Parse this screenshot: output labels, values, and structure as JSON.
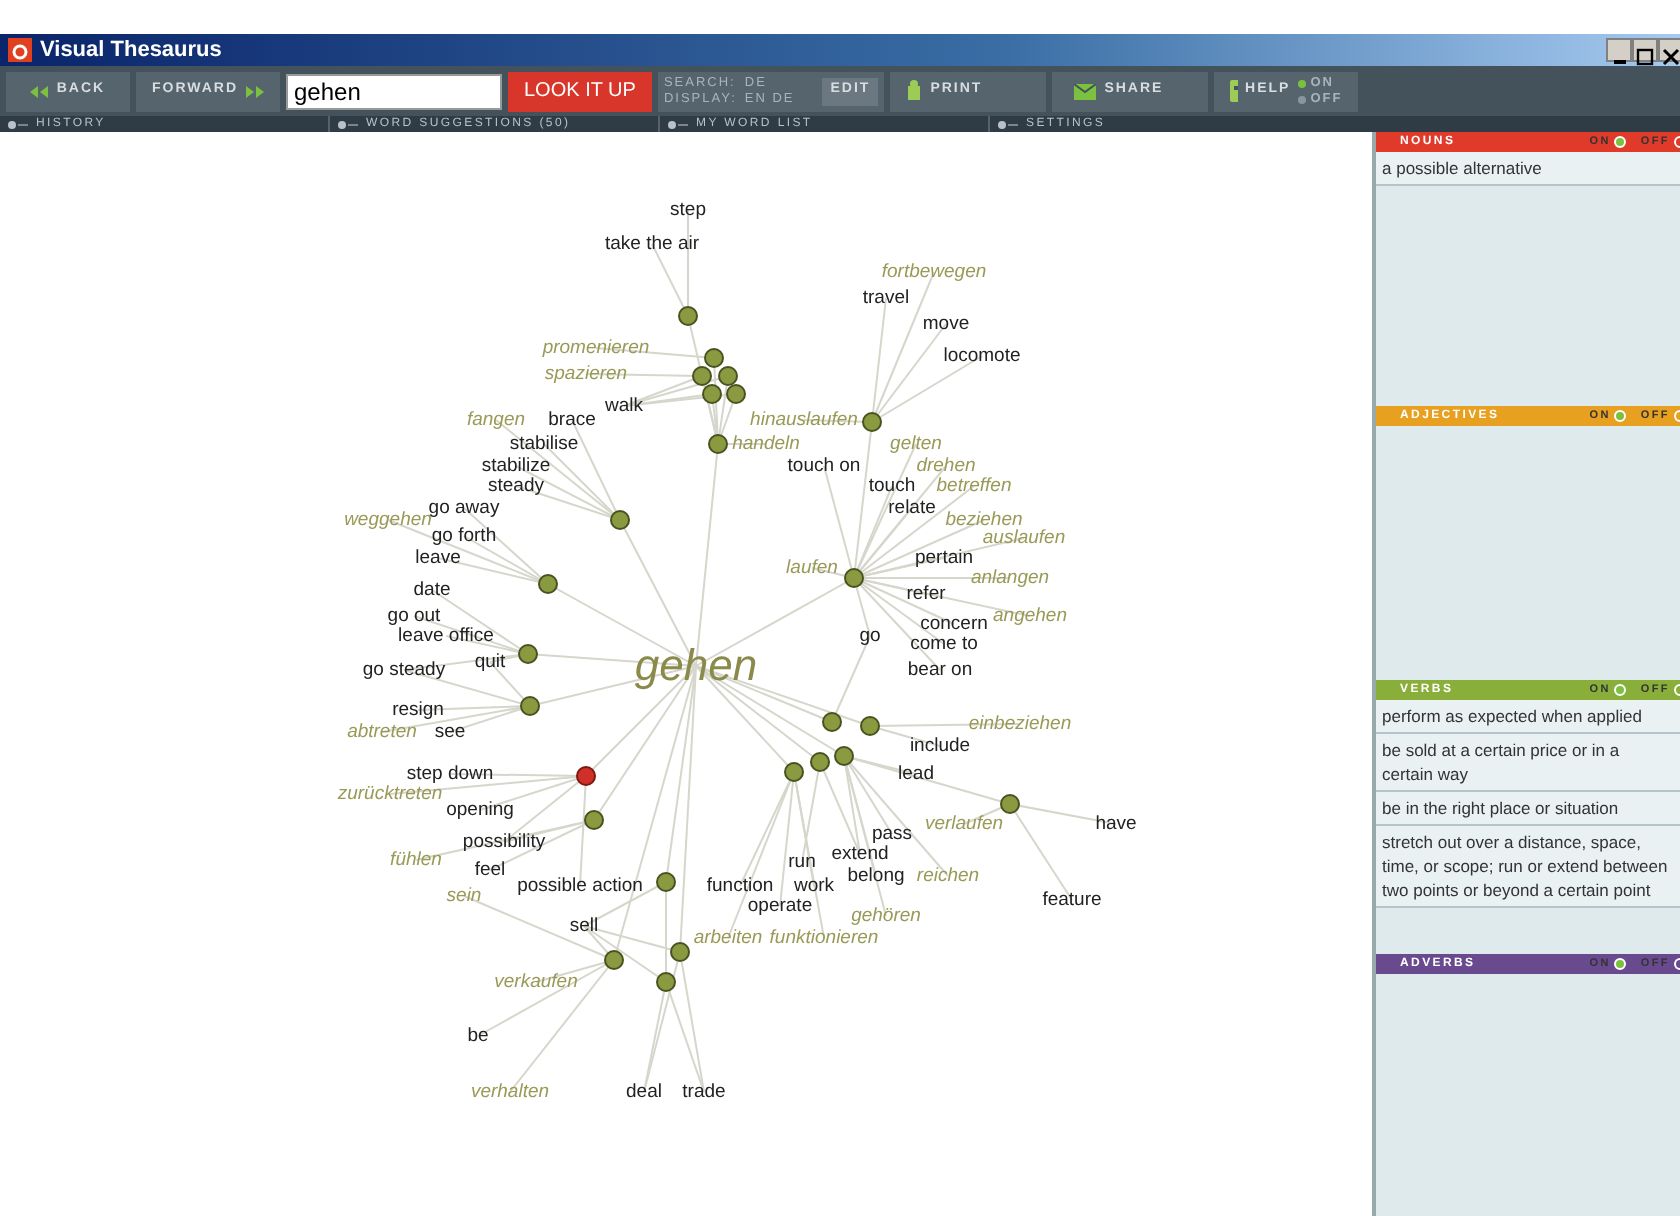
{
  "window": {
    "title": "Visual Thesaurus"
  },
  "toolbar": {
    "back": "BACK",
    "forward": "FORWARD",
    "search_value": "gehen",
    "lookup": "LOOK IT UP",
    "search_label": "SEARCH:",
    "search_langs": "DE",
    "display_label": "DISPLAY:",
    "display_langs": "EN DE",
    "edit": "EDIT",
    "print": "PRINT",
    "share": "SHARE",
    "help": "HELP",
    "help_toggle": {
      "on_label": "ON",
      "off_label": "OFF",
      "on": true
    }
  },
  "subbar": [
    "HISTORY",
    "WORD SUGGESTIONS (50)",
    "MY WORD LIST",
    "SETTINGS"
  ],
  "graph": {
    "center": "gehen",
    "nodes": [
      {
        "kind": "verb"
      },
      {
        "kind": "verb"
      },
      {
        "kind": "verb"
      },
      {
        "kind": "verb"
      },
      {
        "kind": "verb"
      },
      {
        "kind": "verb"
      },
      {
        "kind": "verb"
      },
      {
        "kind": "verb"
      },
      {
        "kind": "verb"
      },
      {
        "kind": "verb"
      },
      {
        "kind": "verb"
      },
      {
        "kind": "verb"
      },
      {
        "kind": "verb"
      },
      {
        "kind": "noun"
      },
      {
        "kind": "verb"
      },
      {
        "kind": "verb"
      },
      {
        "kind": "verb"
      },
      {
        "kind": "verb"
      },
      {
        "kind": "verb"
      },
      {
        "kind": "verb"
      },
      {
        "kind": "verb"
      },
      {
        "kind": "verb"
      },
      {
        "kind": "verb"
      },
      {
        "kind": "verb"
      },
      {
        "kind": "verb"
      }
    ],
    "words": [
      {
        "text": "step",
        "kind": "en"
      },
      {
        "text": "take the air",
        "kind": "en"
      },
      {
        "text": "fortbewegen",
        "kind": "de"
      },
      {
        "text": "travel",
        "kind": "en"
      },
      {
        "text": "move",
        "kind": "en"
      },
      {
        "text": "promenieren",
        "kind": "de"
      },
      {
        "text": "locomote",
        "kind": "en"
      },
      {
        "text": "spazieren",
        "kind": "de"
      },
      {
        "text": "walk",
        "kind": "en"
      },
      {
        "text": "fangen",
        "kind": "de"
      },
      {
        "text": "brace",
        "kind": "en"
      },
      {
        "text": "hinauslaufen",
        "kind": "de"
      },
      {
        "text": "stabilise",
        "kind": "en"
      },
      {
        "text": "handeln",
        "kind": "de"
      },
      {
        "text": "gelten",
        "kind": "de"
      },
      {
        "text": "stabilize",
        "kind": "en"
      },
      {
        "text": "touch on",
        "kind": "en"
      },
      {
        "text": "drehen",
        "kind": "de"
      },
      {
        "text": "steady",
        "kind": "en"
      },
      {
        "text": "touch",
        "kind": "en"
      },
      {
        "text": "betreffen",
        "kind": "de"
      },
      {
        "text": "go away",
        "kind": "en"
      },
      {
        "text": "relate",
        "kind": "en"
      },
      {
        "text": "weggehen",
        "kind": "de"
      },
      {
        "text": "beziehen",
        "kind": "de"
      },
      {
        "text": "go forth",
        "kind": "en"
      },
      {
        "text": "auslaufen",
        "kind": "de"
      },
      {
        "text": "leave",
        "kind": "en"
      },
      {
        "text": "pertain",
        "kind": "en"
      },
      {
        "text": "laufen",
        "kind": "de"
      },
      {
        "text": "anlangen",
        "kind": "de"
      },
      {
        "text": "date",
        "kind": "en"
      },
      {
        "text": "refer",
        "kind": "en"
      },
      {
        "text": "go out",
        "kind": "en"
      },
      {
        "text": "angehen",
        "kind": "de"
      },
      {
        "text": "concern",
        "kind": "en"
      },
      {
        "text": "leave office",
        "kind": "en"
      },
      {
        "text": "go",
        "kind": "en"
      },
      {
        "text": "come to",
        "kind": "en"
      },
      {
        "text": "quit",
        "kind": "en"
      },
      {
        "text": "go steady",
        "kind": "en"
      },
      {
        "text": "bear on",
        "kind": "en"
      },
      {
        "text": "resign",
        "kind": "en"
      },
      {
        "text": "einbeziehen",
        "kind": "de"
      },
      {
        "text": "abtreten",
        "kind": "de"
      },
      {
        "text": "see",
        "kind": "en"
      },
      {
        "text": "include",
        "kind": "en"
      },
      {
        "text": "step down",
        "kind": "en"
      },
      {
        "text": "lead",
        "kind": "en"
      },
      {
        "text": "zurücktreten",
        "kind": "de"
      },
      {
        "text": "opening",
        "kind": "en"
      },
      {
        "text": "verlaufen",
        "kind": "de"
      },
      {
        "text": "have",
        "kind": "en"
      },
      {
        "text": "pass",
        "kind": "en"
      },
      {
        "text": "possibility",
        "kind": "en"
      },
      {
        "text": "extend",
        "kind": "en"
      },
      {
        "text": "fühlen",
        "kind": "de"
      },
      {
        "text": "run",
        "kind": "en"
      },
      {
        "text": "feel",
        "kind": "en"
      },
      {
        "text": "belong",
        "kind": "en"
      },
      {
        "text": "reichen",
        "kind": "de"
      },
      {
        "text": "possible action",
        "kind": "en"
      },
      {
        "text": "function",
        "kind": "en"
      },
      {
        "text": "work",
        "kind": "en"
      },
      {
        "text": "sein",
        "kind": "de"
      },
      {
        "text": "feature",
        "kind": "en"
      },
      {
        "text": "operate",
        "kind": "en"
      },
      {
        "text": "gehören",
        "kind": "de"
      },
      {
        "text": "sell",
        "kind": "en"
      },
      {
        "text": "arbeiten",
        "kind": "de"
      },
      {
        "text": "funktionieren",
        "kind": "de"
      },
      {
        "text": "verkaufen",
        "kind": "de"
      },
      {
        "text": "be",
        "kind": "en"
      },
      {
        "text": "verhalten",
        "kind": "de"
      },
      {
        "text": "deal",
        "kind": "en"
      },
      {
        "text": "trade",
        "kind": "en"
      }
    ]
  },
  "panel": [
    {
      "title": "NOUNS",
      "kind": "noun",
      "on_label": "ON",
      "off_label": "OFF",
      "on": true,
      "definitions": [
        "a possible alternative"
      ]
    },
    {
      "title": "ADJECTIVES",
      "kind": "adjective",
      "on_label": "ON",
      "off_label": "OFF",
      "on": true
    },
    {
      "title": "VERBS",
      "kind": "verb",
      "on_label": "ON",
      "off_label": "OFF",
      "on": true,
      "definitions": [
        "perform as expected when applied",
        "be sold at a certain price or in a certain way",
        "be in the right place or situation",
        "stretch out over a distance, space, time, or scope; run or extend between two points or beyond a certain point"
      ]
    },
    {
      "title": "ADVERBS",
      "kind": "adverb",
      "on_label": "ON",
      "off_label": "OFF",
      "on": true
    }
  ]
}
